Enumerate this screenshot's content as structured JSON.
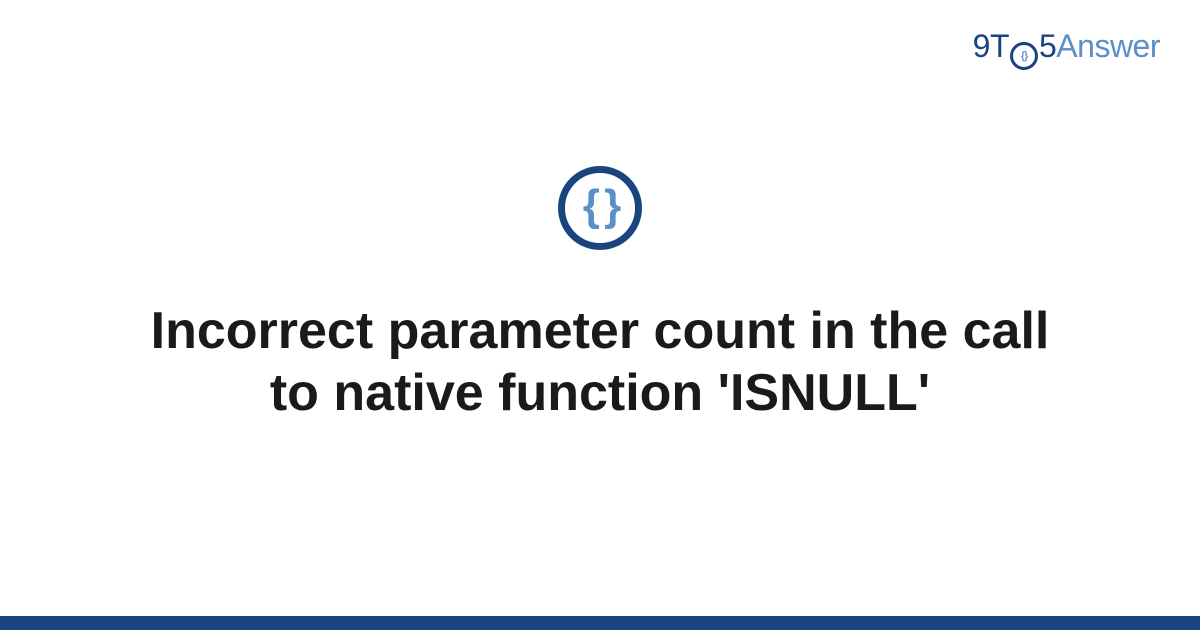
{
  "brand": {
    "part1": "9T",
    "part2": "5",
    "part3": "Answer"
  },
  "badge": {
    "glyph": "{ }"
  },
  "title": "Incorrect parameter count in the call to native function 'ISNULL'",
  "colors": {
    "dark_blue": "#1a4480",
    "light_blue": "#5a8fc7"
  }
}
